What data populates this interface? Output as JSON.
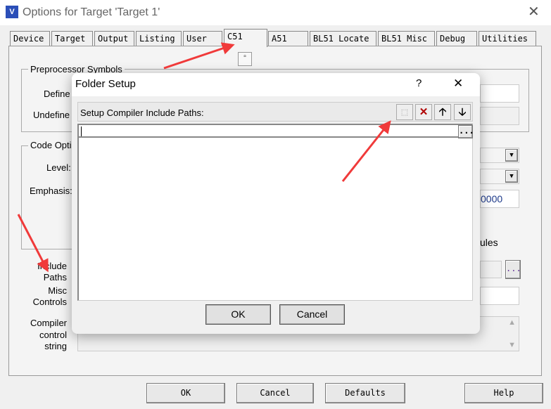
{
  "window": {
    "title": "Options for Target 'Target 1'",
    "icon": "uvision-icon",
    "close": "✕"
  },
  "tabs": [
    "Device",
    "Target",
    "Output",
    "Listing",
    "User",
    "C51",
    "A51",
    "BL51 Locate",
    "BL51 Misc",
    "Debug",
    "Utilities"
  ],
  "active_tab": "C51",
  "background": {
    "preprocessor_group": "Preprocessor Symbols",
    "define_label": "Define",
    "undefine_label": "Undefine",
    "code_group": "Code Opti",
    "level_label": "Level:",
    "emphasis_label": "Emphasis:",
    "value_field": "0000",
    "rules_text": "ules",
    "include_label_1": "Include",
    "include_label_2": "Paths",
    "misc_label_1": "Misc",
    "misc_label_2": "Controls",
    "compiler_label_1": "Compiler",
    "compiler_label_2": "control",
    "compiler_label_3": "string",
    "browse": "..."
  },
  "buttons": {
    "ok": "OK",
    "cancel": "Cancel",
    "defaults": "Defaults",
    "help": "Help"
  },
  "folder_dialog": {
    "title": "Folder Setup",
    "help": "?",
    "close": "✕",
    "header_label": "Setup Compiler Include Paths:",
    "tools": [
      "new-folder-icon",
      "delete-icon",
      "move-up-icon",
      "move-down-icon"
    ],
    "path_value": "",
    "browse": "...",
    "ok": "OK",
    "cancel": "Cancel"
  },
  "colors": {
    "annotation_arrow": "#f03a3a",
    "delete": "#b00000"
  }
}
